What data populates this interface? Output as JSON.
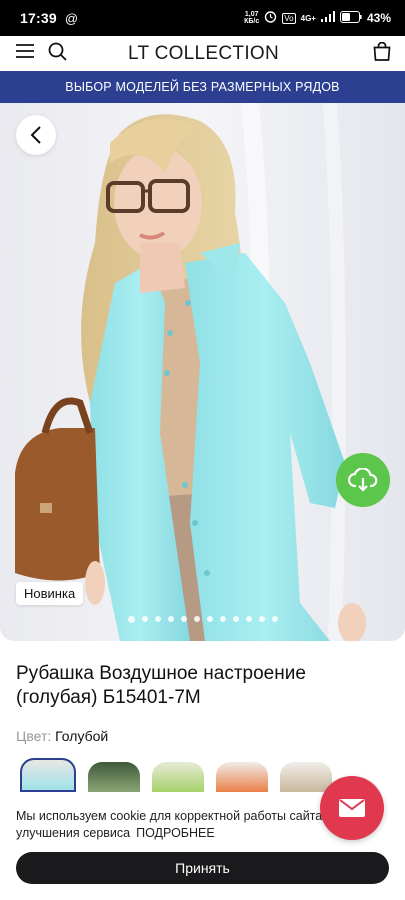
{
  "status_bar": {
    "time": "17:39",
    "net_speed_top": "1,07",
    "net_speed_bottom": "КБ/с",
    "network": "4G+",
    "battery": "43%"
  },
  "header": {
    "logo": "LT COLLECTION"
  },
  "promo": {
    "text": "ВЫБОР МОДЕЛЕЙ БЕЗ РАЗМЕРНЫХ РЯДОВ"
  },
  "gallery": {
    "badge": "Новинка",
    "slide_count": 12,
    "active_slide": 1
  },
  "product": {
    "title": "Рубашка Воздушное настроение (голубая) Б15401-7М",
    "color_label": "Цвет:",
    "color_value": "Голубой"
  },
  "cookie": {
    "text": "Мы используем cookie для корректной работы сайта и улучшения сервиса",
    "link": "ПОДРОБНЕЕ",
    "accept": "Принять"
  },
  "colors": {
    "brand_blue": "#2c3f91",
    "download_green": "#5cc54b",
    "mail_red": "#e0384f"
  }
}
